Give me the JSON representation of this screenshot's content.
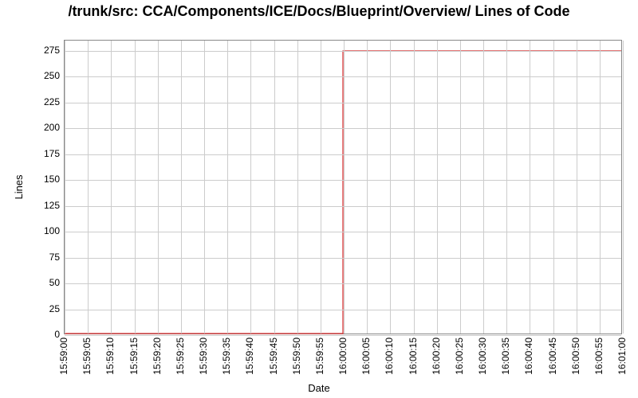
{
  "title": "/trunk/src: CCA/Components/ICE/Docs/Blueprint/Overview/ Lines of Code",
  "xlabel": "Date",
  "ylabel": "Lines",
  "chart_data": {
    "type": "line",
    "x": [
      "15:59:00",
      "15:59:05",
      "15:59:10",
      "15:59:15",
      "15:59:20",
      "15:59:25",
      "15:59:30",
      "15:59:35",
      "15:59:40",
      "15:59:45",
      "15:59:50",
      "15:59:55",
      "16:00:00",
      "16:00:05",
      "16:00:10",
      "16:00:15",
      "16:00:20",
      "16:00:25",
      "16:00:30",
      "16:00:35",
      "16:00:40",
      "16:00:45",
      "16:00:50",
      "16:00:55",
      "16:01:00"
    ],
    "series": [
      {
        "name": "Lines of Code",
        "color": "#d62728",
        "values": [
          0,
          0,
          0,
          0,
          0,
          0,
          0,
          0,
          0,
          0,
          0,
          0,
          275,
          275,
          275,
          275,
          275,
          275,
          275,
          275,
          275,
          275,
          275,
          275,
          275
        ]
      }
    ],
    "ylim": [
      0,
      285
    ],
    "yticks": [
      0,
      25,
      50,
      75,
      100,
      125,
      150,
      175,
      200,
      225,
      250,
      275
    ],
    "xticks": [
      "15:59:00",
      "15:59:05",
      "15:59:10",
      "15:59:15",
      "15:59:20",
      "15:59:25",
      "15:59:30",
      "15:59:35",
      "15:59:40",
      "15:59:45",
      "15:59:50",
      "15:59:55",
      "16:00:00",
      "16:00:05",
      "16:00:10",
      "16:00:15",
      "16:00:20",
      "16:00:25",
      "16:00:30",
      "16:00:35",
      "16:00:40",
      "16:00:45",
      "16:00:50",
      "16:00:55",
      "16:01:00"
    ]
  }
}
